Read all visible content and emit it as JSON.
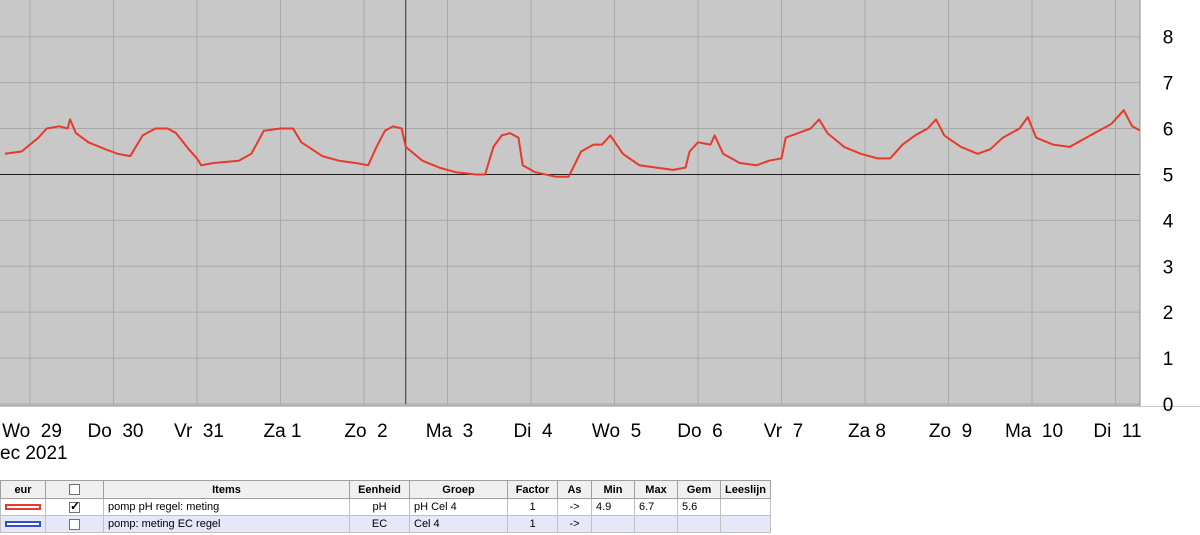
{
  "chart_data": {
    "type": "line",
    "x_tick_labels": [
      "Wo  29",
      "Do  30",
      "Vr  31",
      "Za 1",
      "Zo  2",
      "Ma  3",
      "Di  4",
      "Wo  5",
      "Do  6",
      "Vr  7",
      "Za 8",
      "Zo  9",
      "Ma  10",
      "Di  11"
    ],
    "x_axis_year_label": "ec 2021",
    "ylim": [
      0,
      8.8
    ],
    "y_ticks": [
      0,
      1,
      2,
      3,
      4,
      5,
      6,
      7,
      8
    ],
    "grid": true,
    "reference_line_y": 5,
    "cursor_day": 4.5,
    "xlim": [
      -0.3,
      13.6
    ],
    "series": [
      {
        "name": "pomp pH regel: meting",
        "color": "#e8392b",
        "points": [
          [
            -0.3,
            5.45
          ],
          [
            -0.1,
            5.5
          ],
          [
            0.1,
            5.8
          ],
          [
            0.2,
            6.0
          ],
          [
            0.35,
            6.05
          ],
          [
            0.45,
            6.0
          ],
          [
            0.48,
            6.2
          ],
          [
            0.55,
            5.9
          ],
          [
            0.7,
            5.7
          ],
          [
            0.9,
            5.55
          ],
          [
            1.05,
            5.45
          ],
          [
            1.2,
            5.4
          ],
          [
            1.25,
            5.55
          ],
          [
            1.35,
            5.85
          ],
          [
            1.5,
            6.0
          ],
          [
            1.65,
            6.0
          ],
          [
            1.75,
            5.9
          ],
          [
            1.9,
            5.55
          ],
          [
            2.0,
            5.35
          ],
          [
            2.05,
            5.2
          ],
          [
            2.2,
            5.25
          ],
          [
            2.5,
            5.3
          ],
          [
            2.65,
            5.45
          ],
          [
            2.8,
            5.95
          ],
          [
            3.0,
            6.0
          ],
          [
            3.15,
            6.0
          ],
          [
            3.25,
            5.7
          ],
          [
            3.5,
            5.4
          ],
          [
            3.7,
            5.3
          ],
          [
            3.9,
            5.25
          ],
          [
            4.05,
            5.2
          ],
          [
            4.15,
            5.6
          ],
          [
            4.25,
            5.95
          ],
          [
            4.35,
            6.05
          ],
          [
            4.45,
            6.0
          ],
          [
            4.5,
            5.6
          ],
          [
            4.7,
            5.3
          ],
          [
            4.9,
            5.15
          ],
          [
            5.1,
            5.05
          ],
          [
            5.35,
            5.0
          ],
          [
            5.45,
            5.0
          ],
          [
            5.55,
            5.6
          ],
          [
            5.65,
            5.85
          ],
          [
            5.75,
            5.9
          ],
          [
            5.85,
            5.8
          ],
          [
            5.9,
            5.2
          ],
          [
            6.05,
            5.05
          ],
          [
            6.3,
            4.95
          ],
          [
            6.45,
            4.95
          ],
          [
            6.6,
            5.5
          ],
          [
            6.75,
            5.65
          ],
          [
            6.85,
            5.65
          ],
          [
            6.95,
            5.85
          ],
          [
            7.1,
            5.45
          ],
          [
            7.3,
            5.2
          ],
          [
            7.5,
            5.15
          ],
          [
            7.7,
            5.1
          ],
          [
            7.85,
            5.15
          ],
          [
            7.9,
            5.5
          ],
          [
            8.0,
            5.7
          ],
          [
            8.15,
            5.65
          ],
          [
            8.2,
            5.85
          ],
          [
            8.3,
            5.45
          ],
          [
            8.5,
            5.25
          ],
          [
            8.7,
            5.2
          ],
          [
            8.85,
            5.3
          ],
          [
            9.0,
            5.35
          ],
          [
            9.05,
            5.8
          ],
          [
            9.2,
            5.9
          ],
          [
            9.35,
            6.0
          ],
          [
            9.45,
            6.2
          ],
          [
            9.55,
            5.9
          ],
          [
            9.75,
            5.6
          ],
          [
            9.95,
            5.45
          ],
          [
            10.15,
            5.35
          ],
          [
            10.3,
            5.35
          ],
          [
            10.45,
            5.65
          ],
          [
            10.6,
            5.85
          ],
          [
            10.75,
            6.0
          ],
          [
            10.85,
            6.2
          ],
          [
            10.95,
            5.85
          ],
          [
            11.15,
            5.6
          ],
          [
            11.35,
            5.45
          ],
          [
            11.5,
            5.55
          ],
          [
            11.65,
            5.8
          ],
          [
            11.85,
            6.0
          ],
          [
            11.95,
            6.25
          ],
          [
            12.05,
            5.8
          ],
          [
            12.25,
            5.65
          ],
          [
            12.45,
            5.6
          ],
          [
            12.6,
            5.75
          ],
          [
            12.8,
            5.95
          ],
          [
            12.95,
            6.1
          ],
          [
            13.1,
            6.4
          ],
          [
            13.2,
            6.05
          ],
          [
            13.4,
            5.85
          ],
          [
            13.6,
            5.75
          ],
          [
            13.8,
            5.6
          ],
          [
            13.95,
            5.75
          ],
          [
            14.1,
            5.9
          ],
          [
            14.2,
            6.0
          ],
          [
            14.3,
            6.25
          ],
          [
            14.4,
            5.95
          ],
          [
            14.6,
            5.75
          ],
          [
            14.8,
            5.65
          ],
          [
            14.95,
            5.55
          ],
          [
            15.05,
            5.9
          ],
          [
            15.2,
            6.0
          ],
          [
            15.4,
            6.1
          ],
          [
            15.5,
            6.1
          ],
          [
            15.55,
            6.3
          ],
          [
            15.65,
            5.9
          ],
          [
            15.85,
            5.75
          ],
          [
            16.05,
            5.7
          ],
          [
            16.25,
            5.8
          ],
          [
            16.35,
            6.1
          ],
          [
            16.55,
            6.2
          ],
          [
            16.75,
            6.3
          ],
          [
            16.85,
            6.5
          ],
          [
            16.95,
            6.0
          ],
          [
            17.15,
            5.8
          ],
          [
            17.35,
            5.75
          ],
          [
            17.5,
            5.9
          ],
          [
            17.6,
            6.2
          ],
          [
            17.8,
            6.4
          ],
          [
            17.95,
            6.55
          ],
          [
            18.0,
            6.65
          ],
          [
            18.1,
            6.35
          ],
          [
            18.2,
            6.2
          ],
          [
            18.35,
            6.05
          ],
          [
            18.5,
            5.95
          ]
        ]
      }
    ]
  },
  "legend": {
    "headers": [
      "eur",
      "",
      "Items",
      "Eenheid",
      "Groep",
      "Factor",
      "As",
      "Min",
      "Max",
      "Gem",
      "Leeslijn"
    ],
    "rows": [
      {
        "checked": true,
        "swatch_color": "#e8392b",
        "items": "pomp pH regel: meting",
        "eenheid": "pH",
        "groep": "pH Cel 4",
        "factor": "1",
        "as": "->",
        "min": "4.9",
        "max": "6.7",
        "gem": "5.6",
        "leeslijn": ""
      },
      {
        "checked": false,
        "swatch_color": "#3050d0",
        "items": "pomp: meting EC regel",
        "eenheid": "EC",
        "groep": "Cel 4",
        "factor": "1",
        "as": "->",
        "min": "",
        "max": "",
        "gem": "",
        "leeslijn": ""
      }
    ]
  }
}
